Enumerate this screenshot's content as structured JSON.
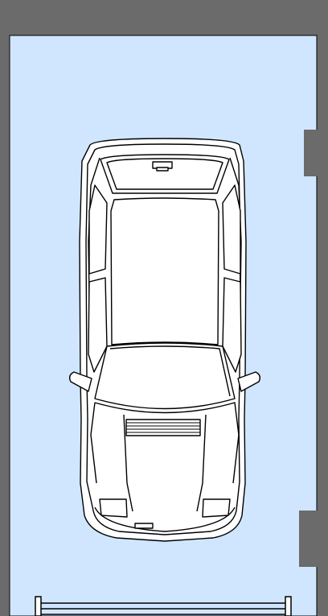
{
  "plan": {
    "colors": {
      "wall": "#6b6b6b",
      "floor": "#d0e6ff",
      "line": "#000000",
      "car_fill": "#ffffff"
    },
    "icons": {
      "car": "car-topdown-icon",
      "door": "garage-door-icon"
    }
  }
}
